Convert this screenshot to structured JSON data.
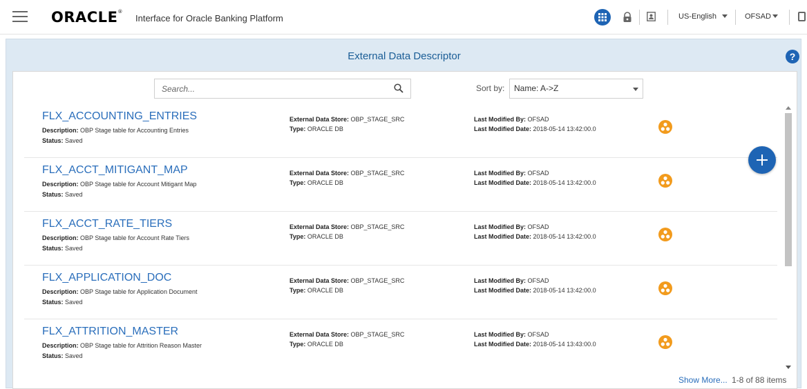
{
  "header": {
    "logo": "ORACLE",
    "logo_mark": "®",
    "app_title": "Interface for Oracle Banking Platform",
    "language": "US-English",
    "user": "OFSAD"
  },
  "panel": {
    "title": "External Data Descriptor",
    "help": "?"
  },
  "toolbar": {
    "search_placeholder": "Search...",
    "sort_label": "Sort by:",
    "sort_value": "Name: A->Z"
  },
  "labels": {
    "description": "Description:",
    "status": "Status:",
    "store": "External Data Store:",
    "type": "Type:",
    "modified_by": "Last Modified By:",
    "modified_date": "Last Modified Date:"
  },
  "rows": [
    {
      "name": "FLX_ACCOUNTING_ENTRIES",
      "description": "OBP Stage table for Accounting Entries",
      "status": "Saved",
      "store": "OBP_STAGE_SRC",
      "type": "ORACLE DB",
      "modified_by": "OFSAD",
      "modified_date": "2018-05-14 13:42:00.0"
    },
    {
      "name": "FLX_ACCT_MITIGANT_MAP",
      "description": "OBP Stage table for Account Mitigant Map",
      "status": "Saved",
      "store": "OBP_STAGE_SRC",
      "type": "ORACLE DB",
      "modified_by": "OFSAD",
      "modified_date": "2018-05-14 13:42:00.0"
    },
    {
      "name": "FLX_ACCT_RATE_TIERS",
      "description": "OBP Stage table for Account Rate Tiers",
      "status": "Saved",
      "store": "OBP_STAGE_SRC",
      "type": "ORACLE DB",
      "modified_by": "OFSAD",
      "modified_date": "2018-05-14 13:42:00.0"
    },
    {
      "name": "FLX_APPLICATION_DOC",
      "description": "OBP Stage table for Application Document",
      "status": "Saved",
      "store": "OBP_STAGE_SRC",
      "type": "ORACLE DB",
      "modified_by": "OFSAD",
      "modified_date": "2018-05-14 13:42:00.0"
    },
    {
      "name": "FLX_ATTRITION_MASTER",
      "description": "OBP Stage table for Attrition Reason Master",
      "status": "Saved",
      "store": "OBP_STAGE_SRC",
      "type": "ORACLE DB",
      "modified_by": "OFSAD",
      "modified_date": "2018-05-14 13:43:00.0"
    }
  ],
  "footer": {
    "show_more": "Show More...",
    "count": "1-8 of 88 items"
  },
  "colors": {
    "accent": "#1e64b4",
    "link": "#2a6ebb",
    "row_icon": "#f29b1d",
    "panel_bg": "#dde9f3"
  },
  "icons": {
    "menu": "hamburger-icon",
    "apps": "grid-icon",
    "lock": "lock-icon",
    "card": "contact-card-icon",
    "search": "search-icon",
    "add": "plus-icon",
    "row_action": "hierarchy-icon"
  }
}
